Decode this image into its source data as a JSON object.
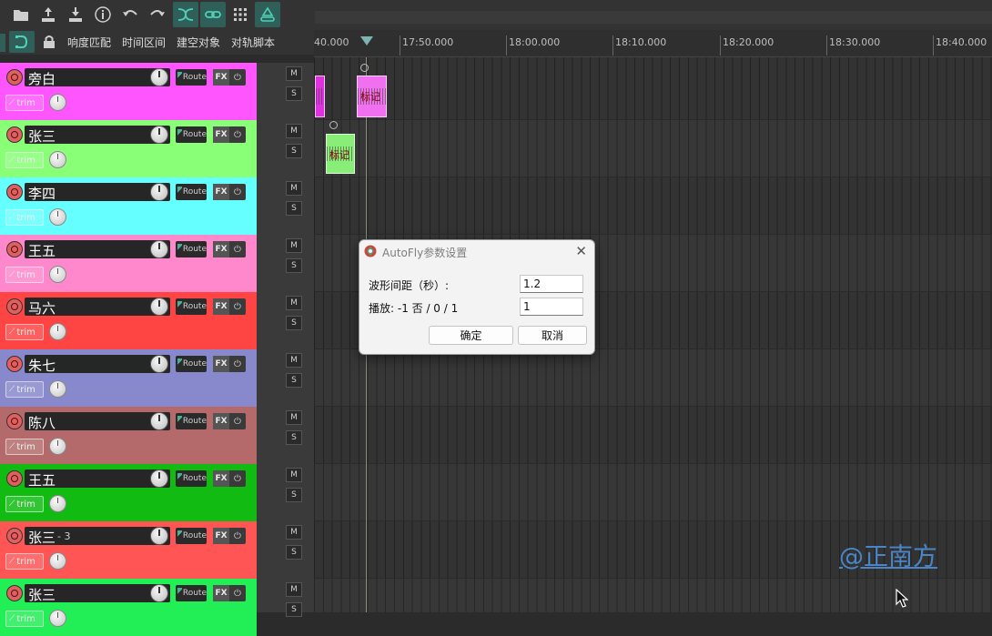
{
  "toolbar": {
    "actions": [
      "folder-icon",
      "upload-icon",
      "download-icon",
      "info-icon",
      "undo-icon",
      "redo-icon",
      "crossfade-icon",
      "link-icon",
      "grid-icon",
      "route-icon"
    ],
    "row2": {
      "loudness_match": "响度匹配",
      "time_range": "时间区间",
      "build_empty_object": "建空对象",
      "track_script": "对轨脚本"
    }
  },
  "ruler": {
    "labels": [
      "40.000",
      "17:50.000",
      "18:00.000",
      "18:10.000",
      "18:20.000",
      "18:30.000",
      "18:40.000"
    ]
  },
  "tracks": [
    {
      "name": "旁白",
      "suffix": "",
      "color": "#ff55ff"
    },
    {
      "name": "张三",
      "suffix": "",
      "color": "#88ff77"
    },
    {
      "name": "李四",
      "suffix": "",
      "color": "#66ffff"
    },
    {
      "name": "王五",
      "suffix": "",
      "color": "#ff88cc"
    },
    {
      "name": "马六",
      "suffix": "",
      "color": "#ff4444"
    },
    {
      "name": "朱七",
      "suffix": "",
      "color": "#8888cc"
    },
    {
      "name": "陈八",
      "suffix": "",
      "color": "#b46a6a"
    },
    {
      "name": "王五",
      "suffix": "",
      "color": "#11bb11"
    },
    {
      "name": "张三",
      "suffix": "- 3",
      "color": "#ff5555"
    },
    {
      "name": "张三",
      "suffix": "",
      "color": "#22ee55"
    }
  ],
  "track_controls": {
    "route_label": "Route",
    "fx_label": "FX",
    "power_label": "⏻",
    "trim_label": "trim",
    "mute_label": "M",
    "solo_label": "S"
  },
  "items": {
    "label": "标记"
  },
  "dialog": {
    "title": "AutoFly参数设置",
    "row1_label": "波形间距（秒）:",
    "row1_value": "1.2",
    "row2_label": "播放: -1 否 / 0 / 1",
    "row2_value": "1",
    "ok_label": "确定",
    "cancel_label": "取消",
    "close_label": "✕"
  },
  "watermark": "@正南方"
}
